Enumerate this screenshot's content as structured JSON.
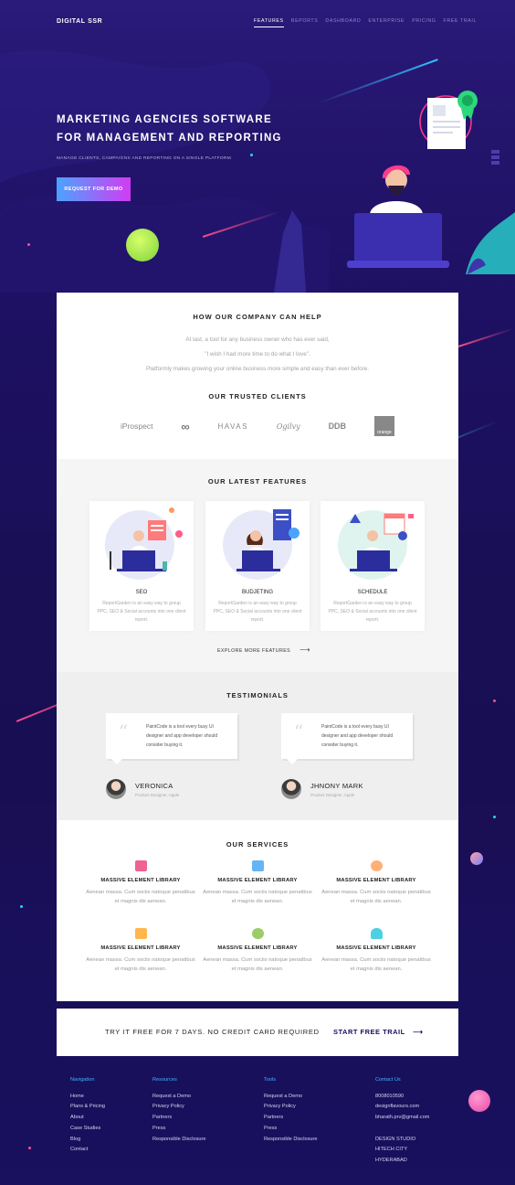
{
  "header": {
    "logo": "DIGITAL SSR",
    "nav": [
      "FEATURES",
      "REPORTS",
      "DASHBOARD",
      "ENTERPRISE",
      "PRICING",
      "FREE TRAIL"
    ]
  },
  "hero": {
    "title_line1": "MARKETING AGENCIES SOFTWARE",
    "title_line2": "FOR MANAGEMENT AND REPORTING",
    "subtitle": "MANAGE CLIENTS, CAMPAIGNS AND REPORTING ON A SINGLE PLATFORM",
    "cta": "REQUEST FOR DEMO"
  },
  "help": {
    "title": "HOW OUR COMPANY CAN HELP",
    "line1": "At last, a tool for any business owner who has ever said,",
    "line2": "\"I wish I had more time to do what I love\".",
    "line3": "Platformly makes growing your online business more simple and easy than ever before."
  },
  "clients": {
    "title": "OUR TRUSTED CLIENTS",
    "logos": [
      "iProspect",
      "∞",
      "HAVAS",
      "Ogilvy",
      "DDB",
      "orange"
    ]
  },
  "features": {
    "title": "OUR LATEST FEATURES",
    "items": [
      {
        "title": "SEO",
        "desc": "ReportGarden is an easy way to group PPC, SEO & Social accounts into one client report."
      },
      {
        "title": "BUDJETING",
        "desc": "ReportGarden is an easy way to group PPC, SEO & Social accounts into one client report."
      },
      {
        "title": "SCHEDULE",
        "desc": "ReportGarden is an easy way to group PPC, SEO & Social accounts into one client report."
      }
    ],
    "explore": "EXPLORE MORE FEATURES"
  },
  "testimonials": {
    "title": "TESTIMONIALS",
    "items": [
      {
        "quote": "PaintCode is a tool every busy UI designer and app developer should consider buying it.",
        "name": "VERONICA",
        "role": "Product Designer, Apple"
      },
      {
        "quote": "PaintCode is a tool every busy UI designer and app developer should consider buying it.",
        "name": "JHNONY MARK",
        "role": "Product Designer, Apple"
      }
    ]
  },
  "services": {
    "title": "OUR SERVICES",
    "items": [
      {
        "title": "MASSIVE ELEMENT LIBRARY",
        "desc": "Aenean massa. Cum sociis natoque penatibus et magnis dis aenean.",
        "icon": "bag-icon",
        "color": "#f06292"
      },
      {
        "title": "MASSIVE ELEMENT LIBRARY",
        "desc": "Aenean massa. Cum sociis natoque penatibus et magnis dis aenean.",
        "icon": "mail-icon",
        "color": "#64b5f6"
      },
      {
        "title": "MASSIVE ELEMENT LIBRARY",
        "desc": "Aenean massa. Cum sociis natoque penatibus et magnis dis aenean.",
        "icon": "globe-icon",
        "color": "#ffb074"
      },
      {
        "title": "MASSIVE ELEMENT LIBRARY",
        "desc": "Aenean massa. Cum sociis natoque penatibus et magnis dis aenean.",
        "icon": "building-icon",
        "color": "#ffb74d"
      },
      {
        "title": "MASSIVE ELEMENT LIBRARY",
        "desc": "Aenean massa. Cum sociis natoque penatibus et magnis dis aenean.",
        "icon": "pie-icon",
        "color": "#9ccc65"
      },
      {
        "title": "MASSIVE ELEMENT LIBRARY",
        "desc": "Aenean massa. Cum sociis natoque penatibus et magnis dis aenean.",
        "icon": "bell-icon",
        "color": "#4dd0e1"
      }
    ]
  },
  "trial": {
    "text": "TRY IT FREE FOR 7 DAYS. NO CREDIT CARD REQUIRED",
    "cta": "START FREE TRAIL"
  },
  "footer": {
    "navigation": {
      "title": "Navigation",
      "items": [
        "Home",
        "Plans & Pricing",
        "About",
        "Case Studies",
        "Blog",
        "Contact"
      ]
    },
    "resources": {
      "title": "Resources",
      "items": [
        "Request a Demo",
        "Privacy Policy",
        "Partners",
        "Press",
        "Responsible Disclosure"
      ]
    },
    "tools": {
      "title": "Tools",
      "items": [
        "Request a Demo",
        "Privacy Policy",
        "Partners",
        "Press",
        "Responsible Disclosure"
      ]
    },
    "contact": {
      "title": "Contact Us",
      "items": [
        "8008010590",
        "designflavours.com",
        "bharath.prv@gmail.com",
        "",
        "DESIGN STUDIO",
        "HITECH CITY",
        "HYDERABAD"
      ]
    }
  },
  "colors": {
    "accent": "#3fb6ff",
    "brand": "#1c1060",
    "cta_gradient_start": "#4aa4ff",
    "cta_gradient_end": "#d23bf2"
  }
}
